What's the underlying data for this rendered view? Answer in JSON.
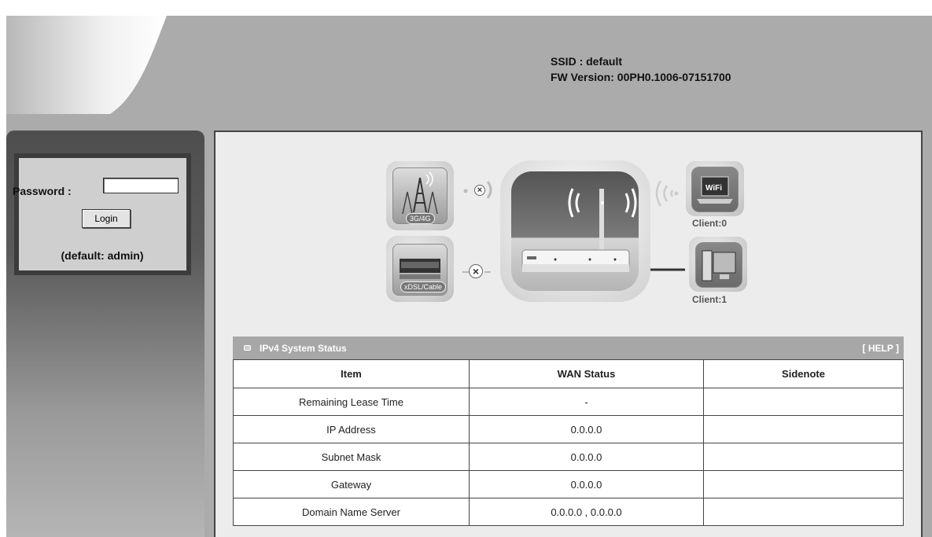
{
  "header": {
    "ssid_text": "SSID : default",
    "fw_text": "FW Version: 00PH0.1006-07151700"
  },
  "login": {
    "password_label": "Password :",
    "password_value": "",
    "login_button": "Login",
    "default_hint": "(default: admin)"
  },
  "diagram": {
    "mobile_label": "3G/4G",
    "dsl_label": "xDSL/Cable",
    "wifi_icon_text": "WiFi",
    "wifi_client": "Client:0",
    "lan_client": "Client:1",
    "mobile_status_icon": "disconnected-x-icon",
    "dsl_status_icon": "disconnected-x-icon"
  },
  "status": {
    "title": "IPv4 System Status",
    "help": "[ HELP ]",
    "columns": [
      "Item",
      "WAN Status",
      "Sidenote"
    ],
    "rows": [
      {
        "item": "Remaining Lease Time",
        "wan": "-",
        "note": ""
      },
      {
        "item": "IP Address",
        "wan": "0.0.0.0",
        "note": ""
      },
      {
        "item": "Subnet Mask",
        "wan": "0.0.0.0",
        "note": ""
      },
      {
        "item": "Gateway",
        "wan": "0.0.0.0",
        "note": ""
      },
      {
        "item": "Domain Name Server",
        "wan": "0.0.0.0 , 0.0.0.0",
        "note": ""
      }
    ]
  },
  "colors": {
    "frame": "#ababab",
    "sidebar_dark": "#4e4e4e",
    "panel_header": "#a7a7a7"
  }
}
